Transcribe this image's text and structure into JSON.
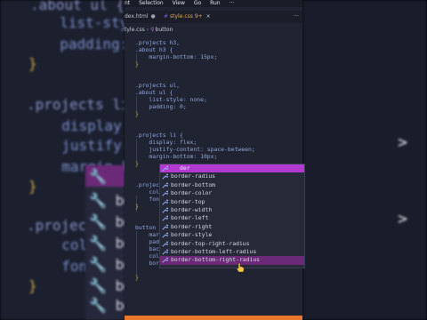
{
  "menubar": [
    "nt",
    "Selection",
    "View",
    "Go",
    "Run",
    "···"
  ],
  "tabs": {
    "index": "dex.html",
    "style": "style.css",
    "style_number": "9+",
    "more": "···"
  },
  "breadcrumb": {
    "file": "tyle.css",
    "symbol": "button"
  },
  "code_lines": [
    ".projects h3,",
    ".about h3 {",
    "    margin-bottom: 15px;",
    "}",
    "",
    ".projects ul,",
    ".about ul {",
    "    list-style: none;",
    "    padding: 0;",
    "}",
    "",
    ".projects li {",
    "    display: flex;",
    "    justify-content: space-between;",
    "    margin-bottom: 10px;",
    "}",
    "",
    ".projec",
    "    col",
    "    fon",
    "}",
    "",
    "button",
    "    marg",
    "    padd",
    "    bac",
    "    colo",
    "    bor",
    "}"
  ],
  "suggestions": {
    "selected_label": "der",
    "items": [
      "border-radius",
      "border-bottom",
      "border-color",
      "border-top",
      "border-width",
      "border-left",
      "border-right",
      "border-style",
      "border-top-right-radius",
      "border-bottom-left-radius",
      "border-bottom-right-radius"
    ],
    "highlighted_index": 10
  },
  "background": {
    "left_lines": [
      ".about ul {",
      "  list-sty",
      "  padding:",
      "}",
      ".projects li",
      "  display:",
      "  justify-co",
      "  margin-b",
      "}",
      ".project",
      "  colo",
      "  fon",
      "}"
    ],
    "popup_words": [
      "bo",
      "bo",
      "bo",
      "bo",
      "bo",
      "bo",
      "bo"
    ]
  },
  "colors": {
    "accent_purple": "#b33ad0",
    "status_orange": "#e8772b",
    "editor_bg": "#202331"
  }
}
